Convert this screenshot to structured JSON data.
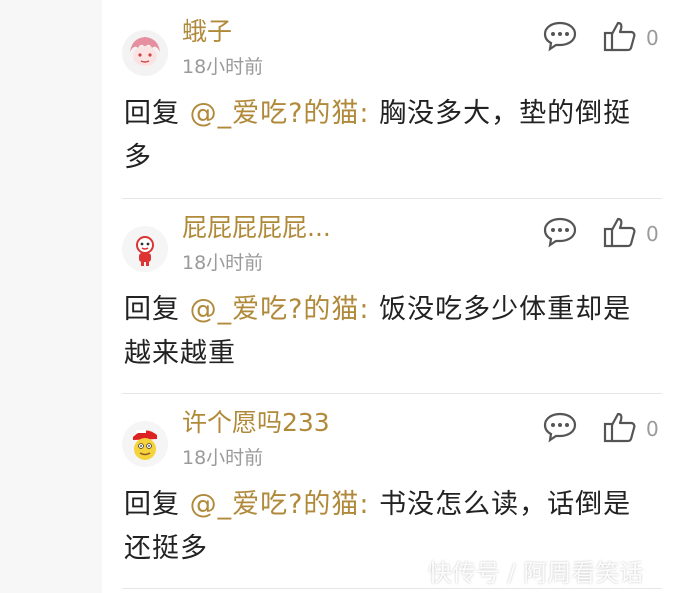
{
  "comments": [
    {
      "username": "蛾子",
      "time": "18小时前",
      "reply_prefix": "回复",
      "mention": "@_爱吃?的猫:",
      "text_line1": "胸没多大，垫的倒挺",
      "text_line2": "多",
      "like_count": "0",
      "avatar_icon": "pink-hair-avatar"
    },
    {
      "username": "屁屁屁屁屁...",
      "time": "18小时前",
      "reply_prefix": "回复",
      "mention": "@_爱吃?的猫:",
      "text_line1": "饭没吃多少体重却是",
      "text_line2": "越来越重",
      "like_count": "0",
      "avatar_icon": "red-mascot-avatar"
    },
    {
      "username": "许个愿吗233",
      "time": "18小时前",
      "reply_prefix": "回复",
      "mention": "@_爱吃?的猫:",
      "text_line1": "书没怎么读，话倒是",
      "text_line2": "还挺多",
      "like_count": "0",
      "avatar_icon": "yellow-character-red-hat-avatar"
    }
  ],
  "watermark": "快传号 / 阿周看笑话",
  "colors": {
    "username": "#b08a3a",
    "mention": "#b08a3a",
    "body_text": "#222222",
    "meta_text": "#9a9a9a",
    "divider": "#e6e6e6"
  }
}
